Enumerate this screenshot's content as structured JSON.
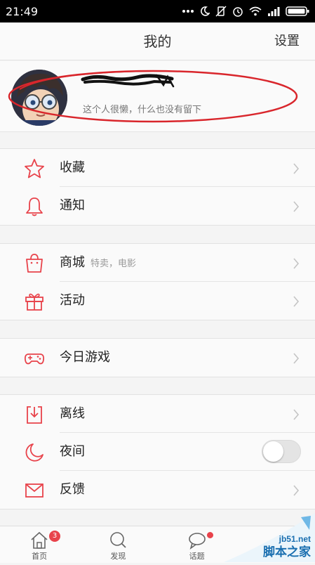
{
  "statusbar": {
    "time": "21:49"
  },
  "header": {
    "title": "我的",
    "settings_label": "设置"
  },
  "profile": {
    "bio": "这个人很懒，什么也没有留下"
  },
  "groups": [
    {
      "items": [
        {
          "icon": "star-icon",
          "label": "收藏"
        },
        {
          "icon": "bell-icon",
          "label": "通知"
        }
      ]
    },
    {
      "items": [
        {
          "icon": "shopping-bag-icon",
          "label": "商城",
          "subtitle": "特卖，电影"
        },
        {
          "icon": "gift-icon",
          "label": "活动"
        }
      ]
    },
    {
      "items": [
        {
          "icon": "gamepad-icon",
          "label": "今日游戏"
        }
      ]
    },
    {
      "items": [
        {
          "icon": "download-icon",
          "label": "离线"
        },
        {
          "icon": "moon-icon",
          "label": "夜间",
          "toggle": false
        },
        {
          "icon": "mail-icon",
          "label": "反馈"
        }
      ]
    }
  ],
  "tabs": [
    {
      "label": "首页",
      "icon": "home-icon",
      "badge": "3"
    },
    {
      "label": "发现",
      "icon": "search-icon"
    },
    {
      "label": "话题",
      "icon": "chat-bubble-icon"
    }
  ],
  "watermark": {
    "line1": "jb51.net",
    "line2": "脚本之家"
  },
  "colors": {
    "accent": "#e8434b",
    "annotation": "#d9262c"
  }
}
